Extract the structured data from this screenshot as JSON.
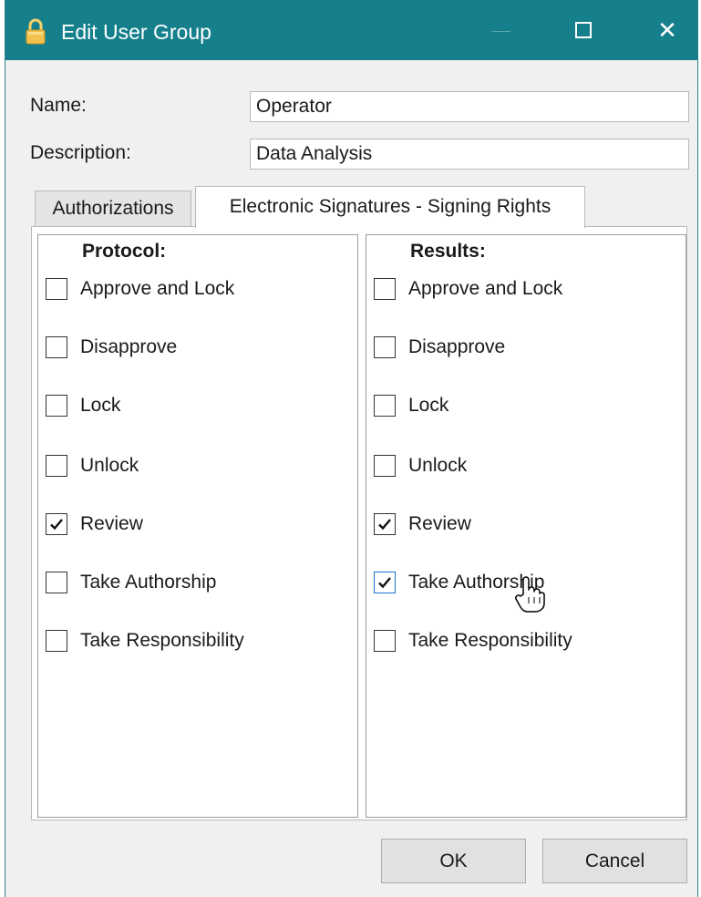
{
  "window": {
    "title": "Edit User Group",
    "title_icon": "lock-icon",
    "titlebar_color": "#15808c",
    "controls": [
      "minimize-icon",
      "maximize-icon",
      "close-icon"
    ],
    "close_glyph": "✕"
  },
  "form": {
    "name_label": "Name:",
    "name_value": "Operator",
    "description_label": "Description:",
    "description_value": "Data Analysis"
  },
  "tabs": [
    {
      "label": "Authorizations",
      "active": false
    },
    {
      "label": "Electronic Signatures - Signing Rights",
      "active": true
    }
  ],
  "protocol": {
    "title": "Protocol:",
    "items": [
      {
        "label": "Approve and Lock",
        "checked": false
      },
      {
        "label": "Disapprove",
        "checked": false
      },
      {
        "label": "Lock",
        "checked": false
      },
      {
        "label": "Unlock",
        "checked": false
      },
      {
        "label": "Review",
        "checked": true
      },
      {
        "label": "Take Authorship",
        "checked": false
      },
      {
        "label": "Take Responsibility",
        "checked": false
      }
    ]
  },
  "results": {
    "title": "Results:",
    "items": [
      {
        "label": "Approve and Lock",
        "checked": false
      },
      {
        "label": "Disapprove",
        "checked": false
      },
      {
        "label": "Lock",
        "checked": false
      },
      {
        "label": "Unlock",
        "checked": false
      },
      {
        "label": "Review",
        "checked": true
      },
      {
        "label": "Take Authorship",
        "checked": true,
        "hovered": true
      },
      {
        "label": "Take Responsibility",
        "checked": false
      }
    ]
  },
  "buttons": {
    "ok": "OK",
    "cancel": "Cancel"
  },
  "cursor": "hand-pointer-icon"
}
